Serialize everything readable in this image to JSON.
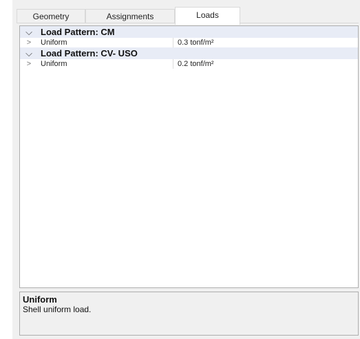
{
  "tabs": [
    {
      "label": "Geometry",
      "selected": false
    },
    {
      "label": "Assignments",
      "selected": false
    },
    {
      "label": "Loads",
      "selected": true
    }
  ],
  "load_patterns": [
    {
      "header": "Load Pattern: CM",
      "expanded": true,
      "expand_icon": "chevron-down-icon",
      "properties": [
        {
          "name": "Uniform",
          "value": "0.3 tonf/m²",
          "expand_icon": "chevron-right-icon"
        }
      ]
    },
    {
      "header": "Load Pattern: CV- USO",
      "expanded": true,
      "expand_icon": "chevron-down-icon",
      "properties": [
        {
          "name": "Uniform",
          "value": "0.2 tonf/m²",
          "expand_icon": "chevron-right-icon"
        }
      ]
    }
  ],
  "description": {
    "title": "Uniform",
    "text": "Shell uniform load."
  },
  "colors": {
    "group_header_bg": "#e8ecf6",
    "panel_bg": "#f0f0f0",
    "border": "#adadad"
  }
}
